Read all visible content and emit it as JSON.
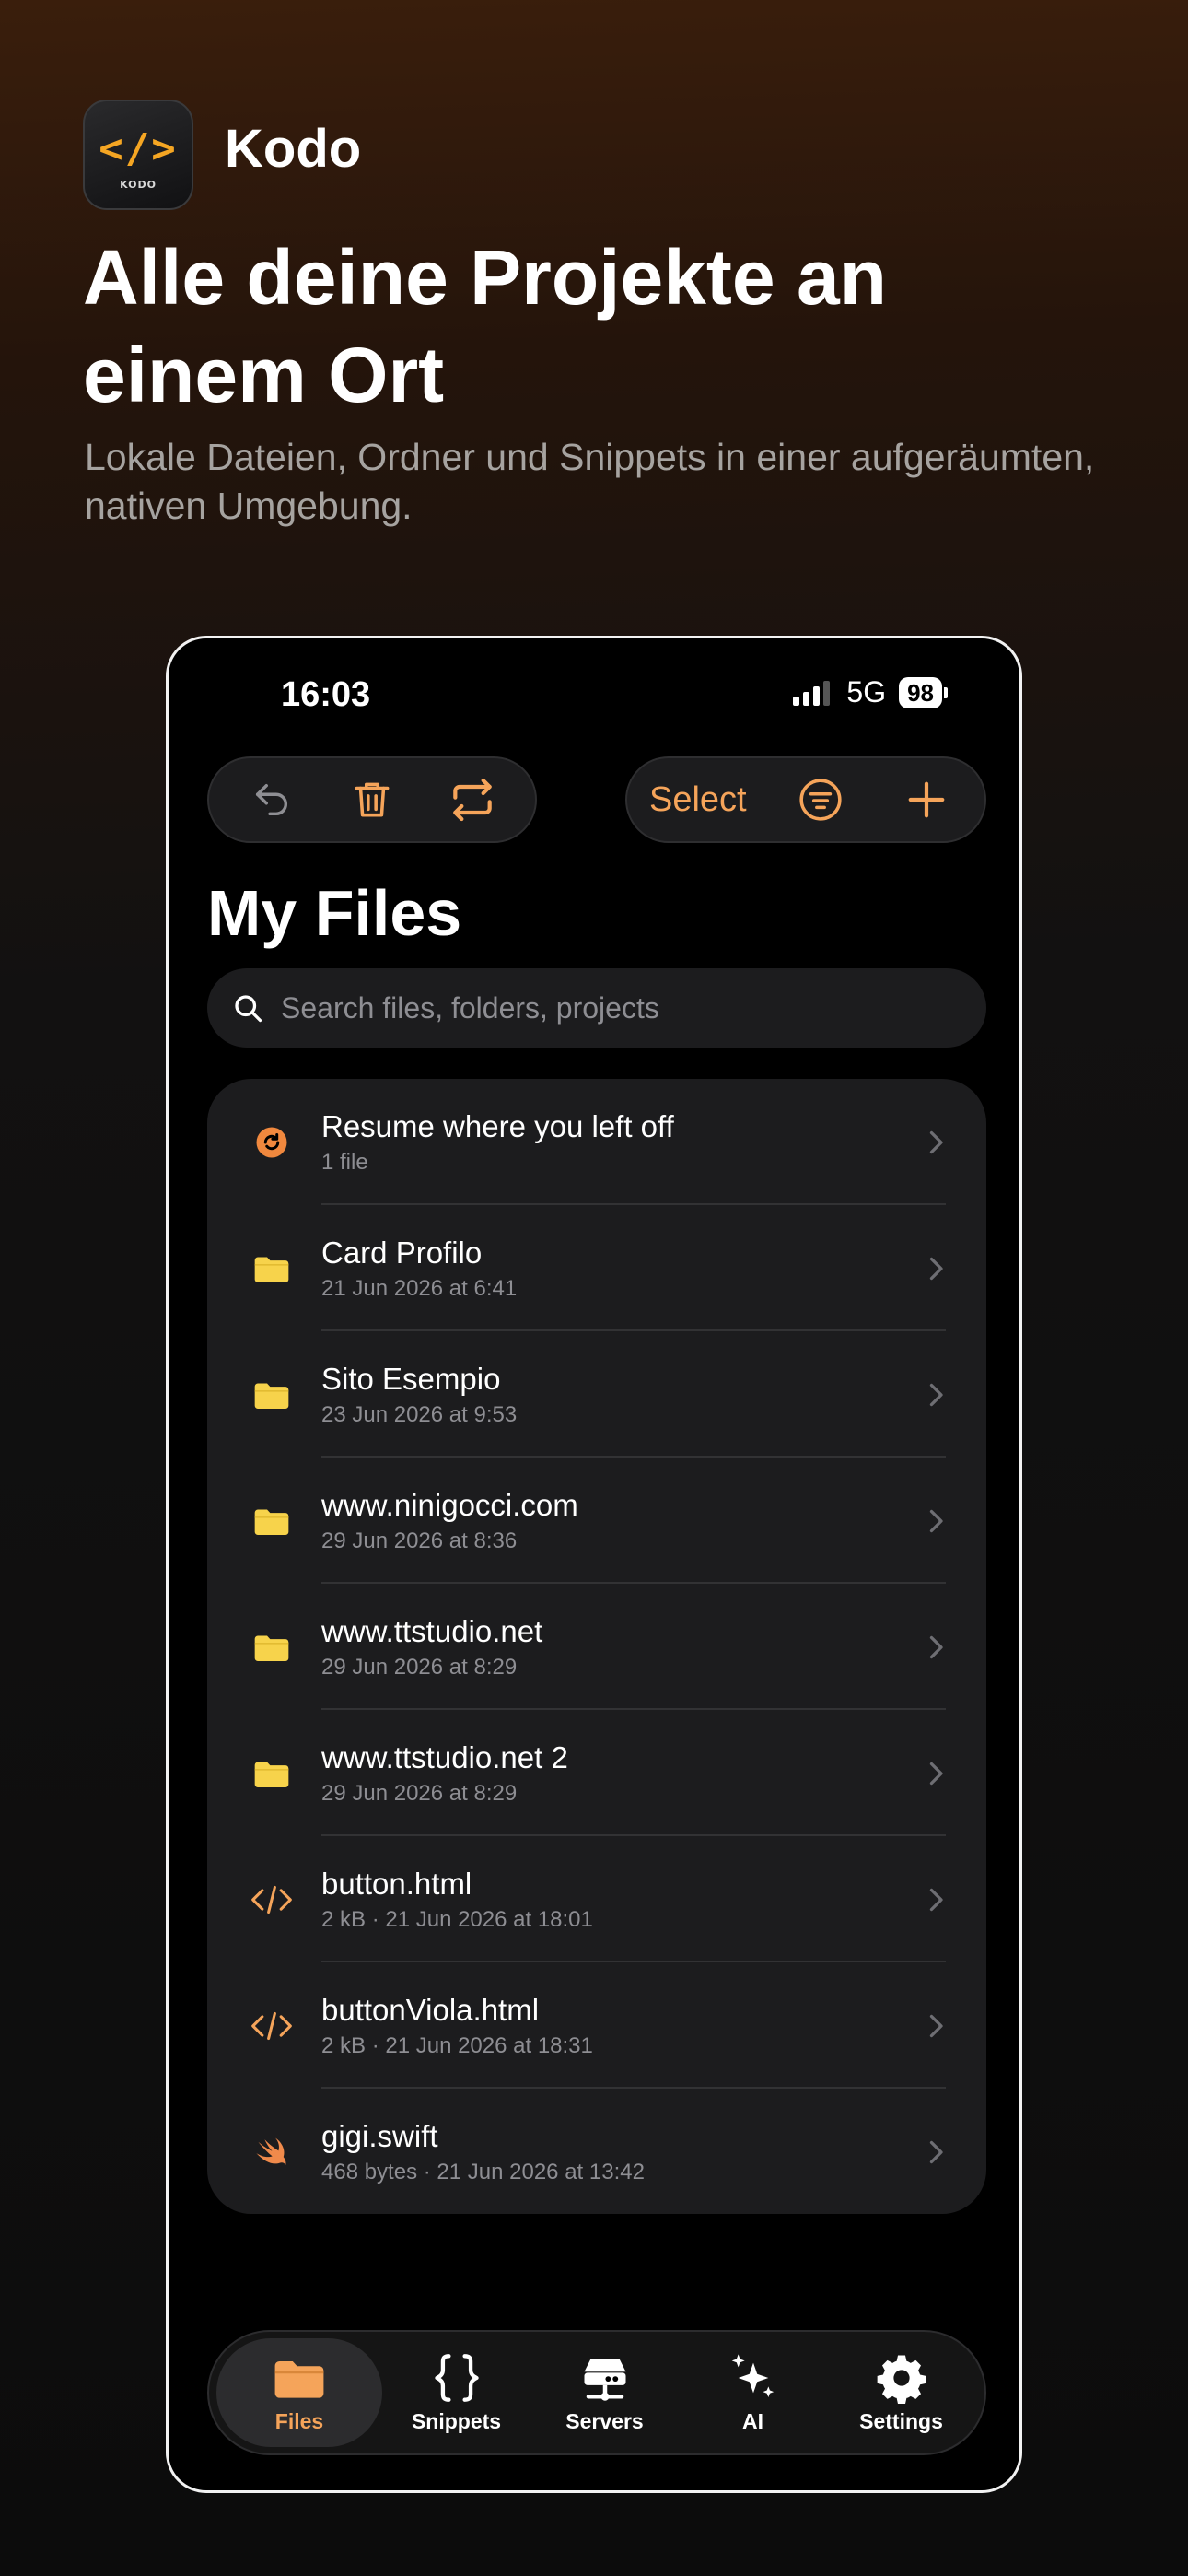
{
  "colors": {
    "accent": "#f5a45a",
    "folder": "#f7d34b",
    "background": "#000000",
    "surface": "#1c1c1e"
  },
  "promo": {
    "app_icon_text": "KODO",
    "app_name": "Kodo",
    "headline": "Alle deine Projekte an einem Ort",
    "subline": "Lokale Dateien, Ordner und Snippets in einer aufgeräumten, nativen Umgebung."
  },
  "status_bar": {
    "time": "16:03",
    "network": "5G",
    "battery": "98"
  },
  "toolbar": {
    "left_icons": [
      "undo-icon",
      "trash-icon",
      "sync-icon"
    ],
    "select_label": "Select",
    "right_icons": [
      "filter-icon",
      "plus-icon"
    ]
  },
  "page": {
    "title": "My Files"
  },
  "search": {
    "placeholder": "Search files, folders, projects",
    "value": ""
  },
  "files": [
    {
      "icon": "resume-icon",
      "title": "Resume where you left off",
      "subtitle": "1 file"
    },
    {
      "icon": "folder-icon",
      "title": "Card Profilo",
      "subtitle": "21 Jun 2026 at 6:41"
    },
    {
      "icon": "folder-icon",
      "title": "Sito Esempio",
      "subtitle": "23 Jun 2026 at 9:53"
    },
    {
      "icon": "folder-icon",
      "title": "www.ninigocci.com",
      "subtitle": "29 Jun 2026 at 8:36"
    },
    {
      "icon": "folder-icon",
      "title": "www.ttstudio.net",
      "subtitle": "29 Jun 2026 at 8:29"
    },
    {
      "icon": "folder-icon",
      "title": "www.ttstudio.net 2",
      "subtitle": "29 Jun 2026 at 8:29"
    },
    {
      "icon": "code-file-icon",
      "title": "button.html",
      "subtitle": "2 kB · 21 Jun 2026 at 18:01"
    },
    {
      "icon": "code-file-icon",
      "title": "buttonViola.html",
      "subtitle": "2 kB · 21 Jun 2026 at 18:31"
    },
    {
      "icon": "swift-file-icon",
      "title": "gigi.swift",
      "subtitle": "468 bytes · 21 Jun 2026 at 13:42"
    }
  ],
  "tabs": [
    {
      "icon": "folder-icon",
      "label": "Files",
      "active": true
    },
    {
      "icon": "braces-icon",
      "label": "Snippets",
      "active": false
    },
    {
      "icon": "server-icon",
      "label": "Servers",
      "active": false
    },
    {
      "icon": "sparkles-icon",
      "label": "AI",
      "active": false
    },
    {
      "icon": "gear-icon",
      "label": "Settings",
      "active": false
    }
  ]
}
